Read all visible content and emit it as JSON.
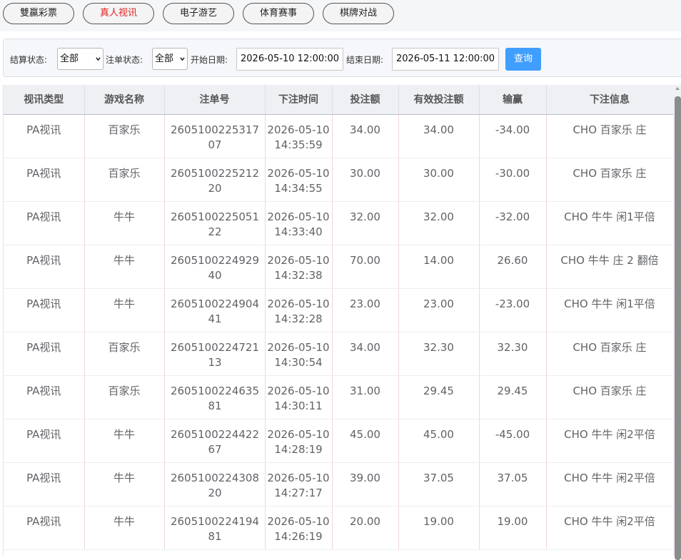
{
  "tabs": [
    {
      "label": "雙贏彩票",
      "active": false
    },
    {
      "label": "真人视讯",
      "active": true
    },
    {
      "label": "电子游艺",
      "active": false
    },
    {
      "label": "体育赛事",
      "active": false
    },
    {
      "label": "棋牌对战",
      "active": false
    }
  ],
  "filters": {
    "settle_label": "结算状态:",
    "settle_value": "全部",
    "order_label": "注单状态:",
    "order_value": "全部",
    "start_label": "开始日期:",
    "start_value": "2026-05-10 12:00:00",
    "end_label": "结束日期:",
    "end_value": "2026-05-11 12:00:00",
    "query_label": "查询"
  },
  "colors": {
    "active_tab_text": "#e0201c",
    "query_button": "#409eff"
  },
  "table": {
    "headers": [
      "视讯类型",
      "游戏名称",
      "注单号",
      "下注时间",
      "投注额",
      "有效投注额",
      "输赢",
      "下注信息"
    ],
    "rows": [
      [
        "PA视讯",
        "百家乐",
        "260510022531707",
        "2026-05-10 14:35:59",
        "34.00",
        "34.00",
        "-34.00",
        "CHO 百家乐 庄"
      ],
      [
        "PA视讯",
        "百家乐",
        "260510022521220",
        "2026-05-10 14:34:55",
        "30.00",
        "30.00",
        "-30.00",
        "CHO 百家乐 庄"
      ],
      [
        "PA视讯",
        "牛牛",
        "260510022505122",
        "2026-05-10 14:33:40",
        "32.00",
        "32.00",
        "-32.00",
        "CHO 牛牛 闲1平倍"
      ],
      [
        "PA视讯",
        "牛牛",
        "260510022492940",
        "2026-05-10 14:32:38",
        "70.00",
        "14.00",
        "26.60",
        "CHO 牛牛 庄 2 翻倍"
      ],
      [
        "PA视讯",
        "牛牛",
        "260510022490441",
        "2026-05-10 14:32:28",
        "23.00",
        "23.00",
        "-23.00",
        "CHO 牛牛 闲1平倍"
      ],
      [
        "PA视讯",
        "百家乐",
        "260510022472113",
        "2026-05-10 14:30:54",
        "34.00",
        "32.30",
        "32.30",
        "CHO 百家乐 庄"
      ],
      [
        "PA视讯",
        "百家乐",
        "260510022463581",
        "2026-05-10 14:30:11",
        "31.00",
        "29.45",
        "29.45",
        "CHO 百家乐 庄"
      ],
      [
        "PA视讯",
        "牛牛",
        "260510022442267",
        "2026-05-10 14:28:19",
        "45.00",
        "45.00",
        "-45.00",
        "CHO 牛牛 闲2平倍"
      ],
      [
        "PA视讯",
        "牛牛",
        "260510022430820",
        "2026-05-10 14:27:17",
        "39.00",
        "37.05",
        "37.05",
        "CHO 牛牛 闲2平倍"
      ],
      [
        "PA视讯",
        "牛牛",
        "260510022419481",
        "2026-05-10 14:26:19",
        "20.00",
        "19.00",
        "19.00",
        "CHO 牛牛 闲2平倍"
      ]
    ]
  }
}
